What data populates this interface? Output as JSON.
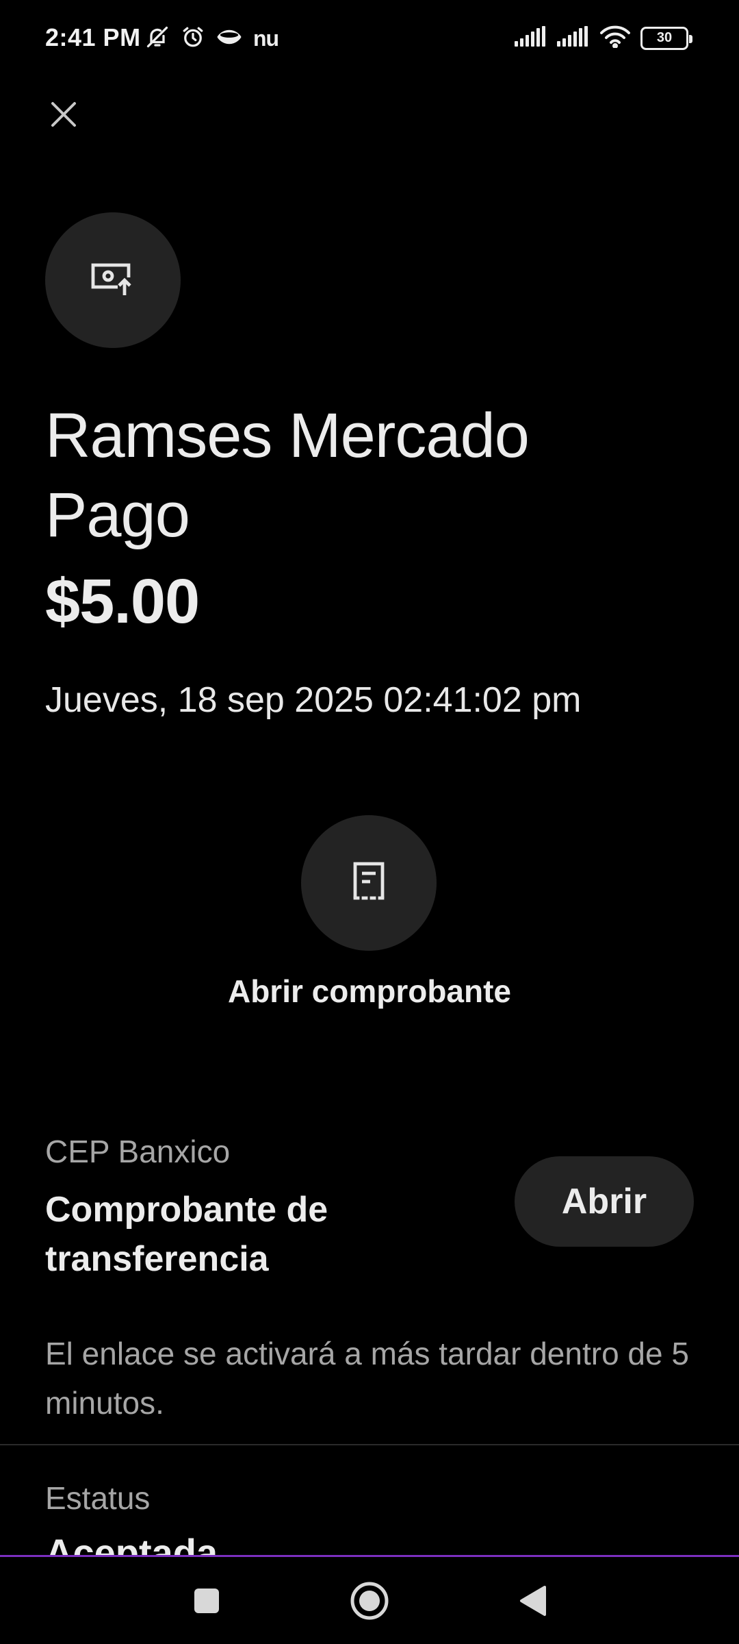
{
  "status_bar": {
    "time": "2:41 PM",
    "left_icons": [
      "bell-off-icon",
      "alarm-icon",
      "eye-icon",
      "nu-app-icon"
    ],
    "nu_label": "nu",
    "battery_level": "30"
  },
  "header": {
    "close_icon": "close-icon"
  },
  "transfer": {
    "merchant_icon": "money-transfer-out-icon",
    "recipient": "Ramses Mercado Pago",
    "amount": "$5.00",
    "datetime": "Jueves, 18 sep 2025 02:41:02 pm"
  },
  "receipt": {
    "icon": "receipt-icon",
    "label": "Abrir comprobante"
  },
  "cep": {
    "caption": "CEP Banxico",
    "title": "Comprobante de transferencia",
    "button_label": "Abrir",
    "notice": "El enlace se activará a más tardar dentro de 5 minutos."
  },
  "status_section": {
    "caption": "Estatus",
    "value": "Aceptada"
  },
  "nav": {
    "recents_icon": "square-icon",
    "home_icon": "circle-home-icon",
    "back_icon": "triangle-back-icon"
  },
  "colors": {
    "background": "#000000",
    "circle_bg": "#232323",
    "text_primary": "#ececec",
    "text_secondary": "#a6a6a6",
    "nav_accent": "#7b2fbf"
  }
}
